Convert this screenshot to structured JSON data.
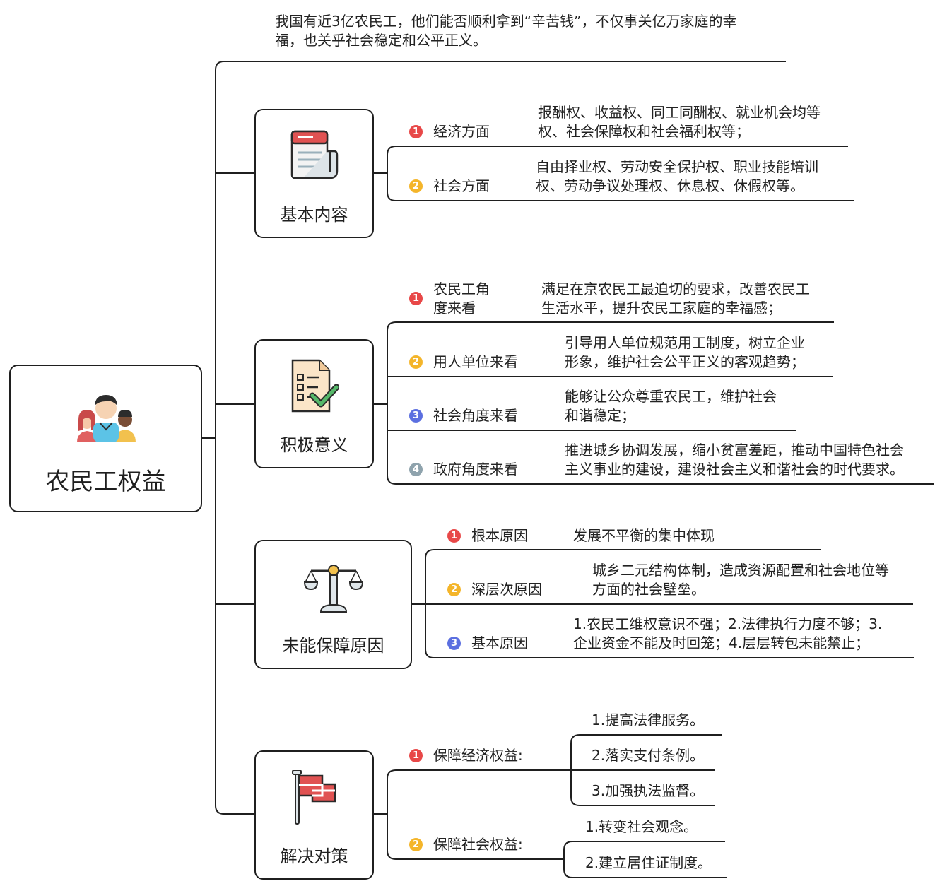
{
  "root": {
    "label": "农民工权益",
    "icon": "people-icon"
  },
  "intro_text": [
    "我国有近3亿农民工，他们能否顺利拿到“辛苦钱”，不仅事关亿万家庭的幸",
    "福，也关乎社会稳定和公平正义。"
  ],
  "branches": [
    {
      "label": "基本内容",
      "icon": "calendar-icon",
      "items": [
        {
          "num": "1",
          "label": "经济方面",
          "text": [
            "报酬权、收益权、同工同酬权、就业机会均等",
            "权、社会保障权和社会福利权等；"
          ]
        },
        {
          "num": "2",
          "label": "社会方面",
          "text": [
            "自由择业权、劳动安全保护权、职业技能培训",
            "权、劳动争议处理权、休息权、休假权等。"
          ]
        }
      ]
    },
    {
      "label": "积极意义",
      "icon": "checklist-icon",
      "items": [
        {
          "num": "1",
          "label": [
            "农民工角",
            "度来看"
          ],
          "text": [
            "满足在京农民工最迫切的要求，改善农民工",
            "生活水平，提升农民工家庭的幸福感；"
          ]
        },
        {
          "num": "2",
          "label": "用人单位来看",
          "text": [
            "引导用人单位规范用工制度，树立企业",
            "形象，维护社会公平正义的客观趋势；"
          ]
        },
        {
          "num": "3",
          "label": "社会角度来看",
          "text": [
            "能够让公众尊重农民工，维护社会",
            "和谐稳定；"
          ]
        },
        {
          "num": "4",
          "label": "政府角度来看",
          "text": [
            "推进城乡协调发展，缩小贫富差距，推动中国特色社会",
            "主义事业的建设，建设社会主义和谐社会的时代要求。"
          ]
        }
      ]
    },
    {
      "label": "未能保障原因",
      "icon": "scales-icon",
      "items": [
        {
          "num": "1",
          "label": "根本原因",
          "text": [
            "发展不平衡的集中体现"
          ]
        },
        {
          "num": "2",
          "label": "深层次原因",
          "text": [
            "城乡二元结构体制，造成资源配置和社会地位等",
            "方面的社会壁垒。"
          ]
        },
        {
          "num": "3",
          "label": "基本原因",
          "text": [
            "1.农民工维权意识不强；2.法律执行力度不够；3.",
            "企业资金不能及时回笼；4.层层转包未能禁止；"
          ]
        }
      ]
    },
    {
      "label": "解决对策",
      "icon": "flag-icon",
      "items": [
        {
          "num": "1",
          "label": "保障经济权益:",
          "subs": [
            "1.提高法律服务。",
            "2.落实支付条例。",
            "3.加强执法监督。"
          ]
        },
        {
          "num": "2",
          "label": "保障社会权益:",
          "subs": [
            "1.转变社会观念。",
            "2.建立居住证制度。"
          ]
        }
      ]
    }
  ],
  "colors": {
    "line": "#1f1f1f",
    "num1": "#e84848",
    "num2": "#f4b52a",
    "num3": "#5b6fe0",
    "num4": "#8fa3ad"
  }
}
